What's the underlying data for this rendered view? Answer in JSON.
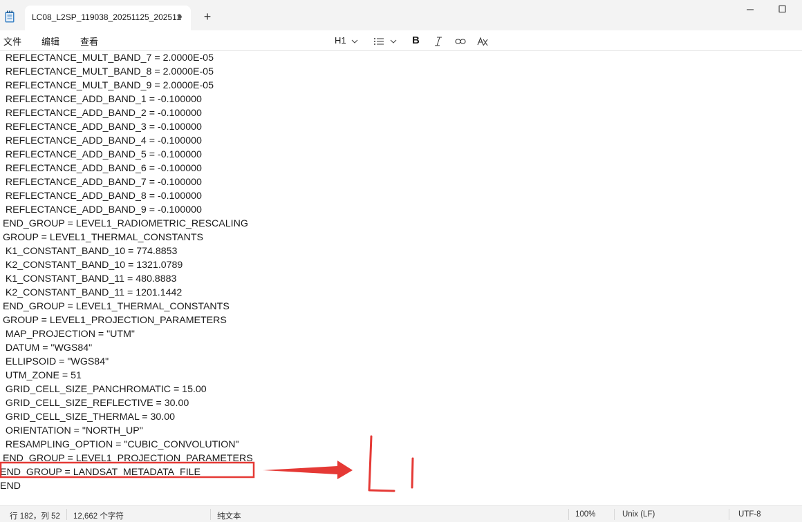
{
  "tab": {
    "title": "LC08_L2SP_119038_20251125_202512"
  },
  "menu": {
    "file": "文件",
    "edit": "编辑",
    "view": "查看"
  },
  "toolbar": {
    "heading": "H1"
  },
  "editor": {
    "lines": [
      "  REFLECTANCE_MULT_BAND_7 = 2.0000E-05",
      "  REFLECTANCE_MULT_BAND_8 = 2.0000E-05",
      "  REFLECTANCE_MULT_BAND_9 = 2.0000E-05",
      "  REFLECTANCE_ADD_BAND_1 = -0.100000",
      "  REFLECTANCE_ADD_BAND_2 = -0.100000",
      "  REFLECTANCE_ADD_BAND_3 = -0.100000",
      "  REFLECTANCE_ADD_BAND_4 = -0.100000",
      "  REFLECTANCE_ADD_BAND_5 = -0.100000",
      "  REFLECTANCE_ADD_BAND_6 = -0.100000",
      "  REFLECTANCE_ADD_BAND_7 = -0.100000",
      "  REFLECTANCE_ADD_BAND_8 = -0.100000",
      "  REFLECTANCE_ADD_BAND_9 = -0.100000",
      " END_GROUP = LEVEL1_RADIOMETRIC_RESCALING",
      " GROUP = LEVEL1_THERMAL_CONSTANTS",
      "  K1_CONSTANT_BAND_10 = 774.8853",
      "  K2_CONSTANT_BAND_10 = 1321.0789",
      "  K1_CONSTANT_BAND_11 = 480.8883",
      "  K2_CONSTANT_BAND_11 = 1201.1442",
      " END_GROUP = LEVEL1_THERMAL_CONSTANTS",
      " GROUP = LEVEL1_PROJECTION_PARAMETERS",
      "  MAP_PROJECTION = \"UTM\"",
      "  DATUM = \"WGS84\"",
      "  ELLIPSOID = \"WGS84\"",
      "  UTM_ZONE = 51",
      "  GRID_CELL_SIZE_PANCHROMATIC = 15.00",
      "  GRID_CELL_SIZE_REFLECTIVE = 30.00",
      "  GRID_CELL_SIZE_THERMAL = 30.00",
      "  ORIENTATION = \"NORTH_UP\"",
      "  RESAMPLING_OPTION = \"CUBIC_CONVOLUTION\"",
      " END_GROUP = LEVEL1_PROJECTION_PARAMETERS",
      "END_GROUP = LANDSAT_METADATA_FILE",
      "END"
    ]
  },
  "annotation": {
    "handwritten_text": "Li",
    "color": "#e53935"
  },
  "status": {
    "position": "行 182，列 52",
    "chars": "12,662 个字符",
    "format": "纯文本",
    "zoom": "100%",
    "line_ending": "Unix (LF)",
    "encoding": "UTF-8"
  }
}
